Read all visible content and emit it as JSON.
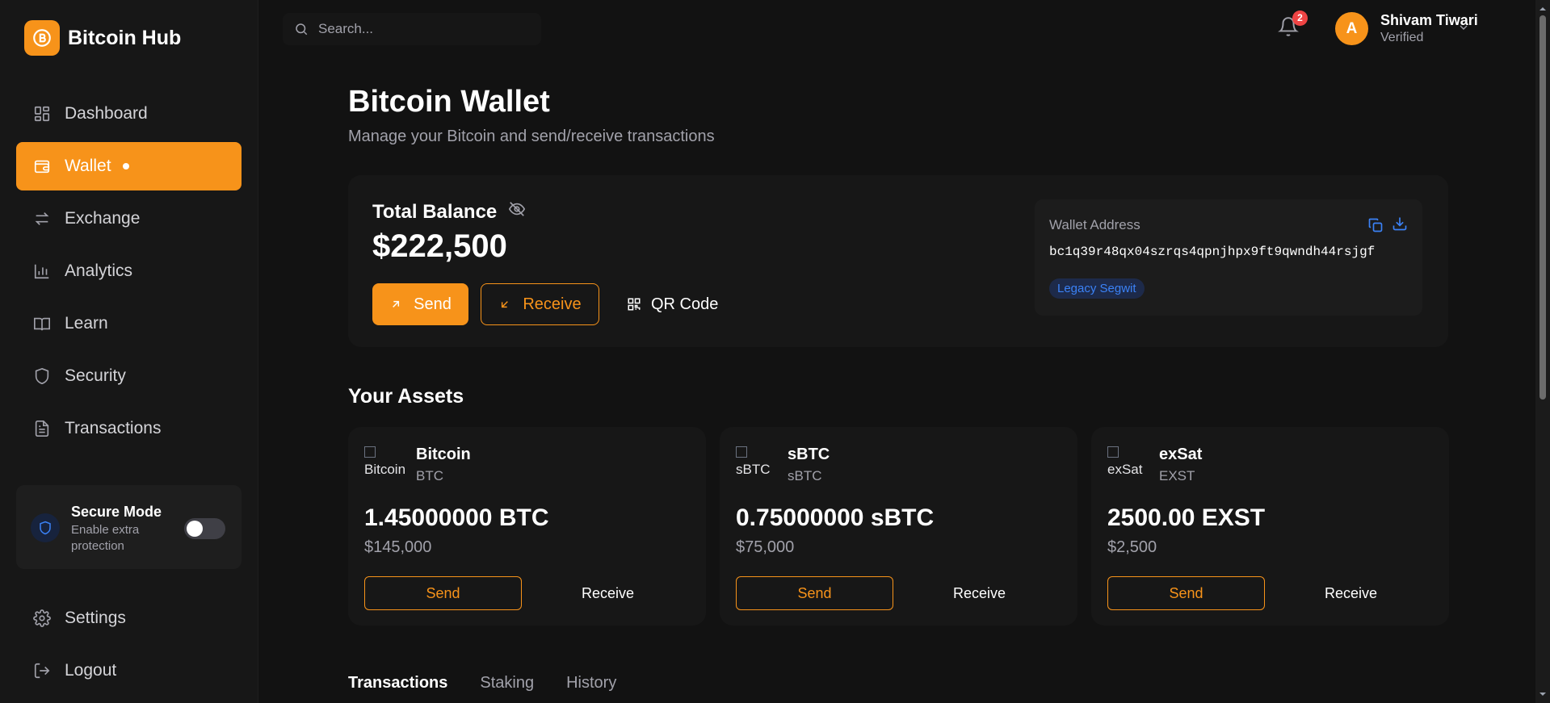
{
  "app": {
    "name": "Bitcoin Hub",
    "accent": "#f7931a"
  },
  "sidebar": {
    "items": [
      {
        "label": "Dashboard",
        "icon": "grid-icon"
      },
      {
        "label": "Wallet",
        "icon": "wallet-icon",
        "active": true
      },
      {
        "label": "Exchange",
        "icon": "arrows-exchange-icon"
      },
      {
        "label": "Analytics",
        "icon": "bar-chart-icon"
      },
      {
        "label": "Learn",
        "icon": "book-icon"
      },
      {
        "label": "Security",
        "icon": "shield-icon"
      },
      {
        "label": "Transactions",
        "icon": "document-icon"
      }
    ],
    "secure_mode": {
      "title": "Secure Mode",
      "subtitle": "Enable extra protection",
      "enabled": false
    },
    "settings_label": "Settings",
    "logout_label": "Logout"
  },
  "topbar": {
    "search_placeholder": "Search...",
    "notification_count": "2",
    "user": {
      "initial": "A",
      "name": "Shivam Tiwari",
      "status": "Verified"
    }
  },
  "main": {
    "title": "Bitcoin Wallet",
    "subtitle": "Manage your Bitcoin and send/receive transactions",
    "balance": {
      "label": "Total Balance",
      "value": "$222,500",
      "send_label": "Send",
      "receive_label": "Receive",
      "qr_label": "QR Code"
    },
    "wallet_address": {
      "label": "Wallet Address",
      "value": "bc1q39r48qx04szrqs4qpnjhpx9ft9qwndh44rsjgf",
      "type_badge": "Legacy Segwit"
    },
    "assets_title": "Your Assets",
    "assets": [
      {
        "name": "Bitcoin",
        "symbol": "BTC",
        "img_alt": "Bitcoin",
        "amount": "1.45000000 BTC",
        "usd": "$145,000",
        "send_label": "Send",
        "receive_label": "Receive"
      },
      {
        "name": "sBTC",
        "symbol": "sBTC",
        "img_alt": "sBTC",
        "amount": "0.75000000 sBTC",
        "usd": "$75,000",
        "send_label": "Send",
        "receive_label": "Receive"
      },
      {
        "name": "exSat",
        "symbol": "EXST",
        "img_alt": "exSat",
        "amount": "2500.00 EXST",
        "usd": "$2,500",
        "send_label": "Send",
        "receive_label": "Receive"
      }
    ],
    "tabs": [
      {
        "label": "Transactions",
        "active": true
      },
      {
        "label": "Staking"
      },
      {
        "label": "History"
      }
    ]
  }
}
